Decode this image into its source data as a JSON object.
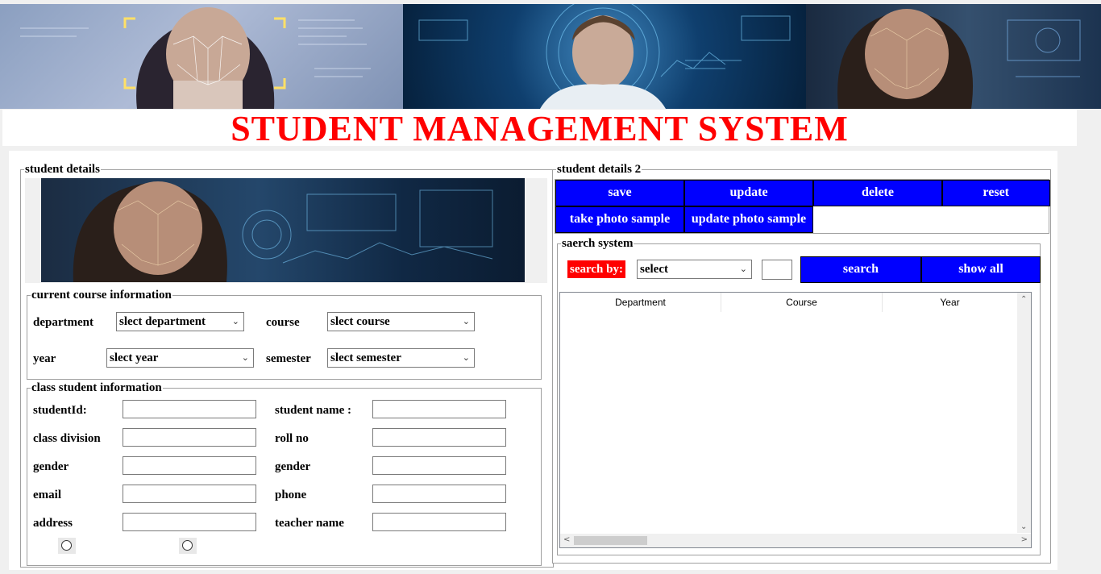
{
  "title": "STUDENT MANAGEMENT SYSTEM",
  "student_details": {
    "legend": "student details",
    "course_frame": {
      "legend": "current course information",
      "department_label": "department",
      "department_value": "slect department",
      "course_label": "course",
      "course_value": "slect course",
      "year_label": "year",
      "year_value": "slect year",
      "semester_label": "semester",
      "semester_value": "slect semester"
    },
    "class_frame": {
      "legend": "class student information",
      "student_id_label": "studentId:",
      "student_name_label": "student name :",
      "class_division_label": "class division",
      "roll_no_label": "roll no",
      "gender_label": "gender",
      "gender2_label": "gender",
      "email_label": "email",
      "phone_label": "phone",
      "address_label": "address",
      "teacher_name_label": "teacher name"
    }
  },
  "student_details_2": {
    "legend": "student details 2",
    "buttons": {
      "save": "save",
      "update": "update",
      "delete": "delete",
      "reset": "reset",
      "take_photo": "take photo sample",
      "update_photo": "update photo sample"
    },
    "search": {
      "legend": "saerch system",
      "search_by_label": "search by:",
      "select_value": "select",
      "search_button": "search",
      "show_all_button": "show all"
    },
    "table": {
      "columns": [
        "Department",
        "Course",
        "Year"
      ]
    }
  },
  "colors": {
    "title": "#ff0000",
    "button_blue": "#0000ff",
    "search_label_bg": "#ff0000"
  }
}
